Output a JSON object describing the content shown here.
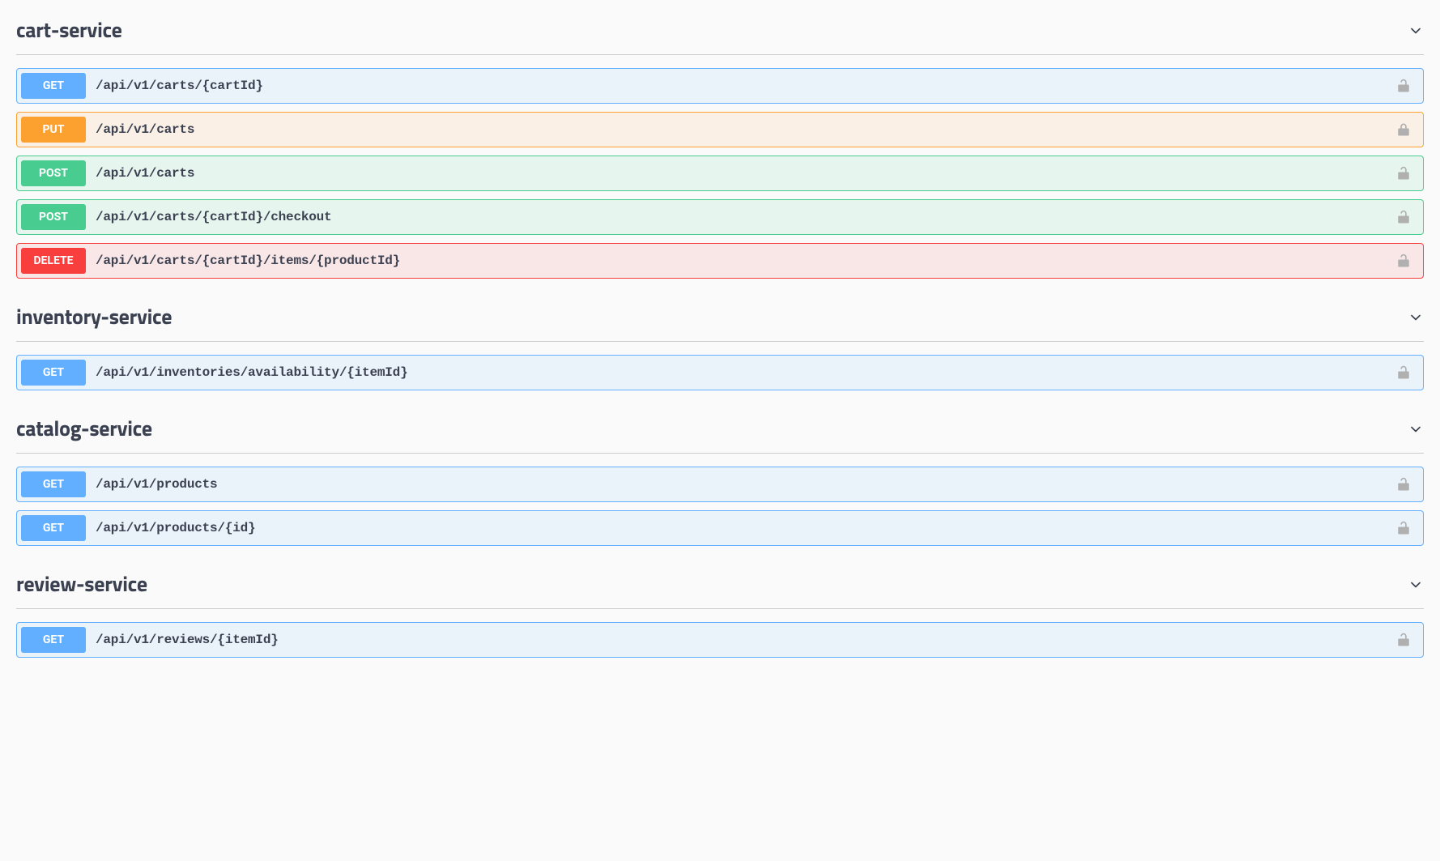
{
  "sections": [
    {
      "name": "cart-service",
      "ops": [
        {
          "method": "GET",
          "path": "/api/v1/carts/{cartId}",
          "locked": false
        },
        {
          "method": "PUT",
          "path": "/api/v1/carts",
          "locked": true
        },
        {
          "method": "POST",
          "path": "/api/v1/carts",
          "locked": false
        },
        {
          "method": "POST",
          "path": "/api/v1/carts/{cartId}/checkout",
          "locked": false
        },
        {
          "method": "DELETE",
          "path": "/api/v1/carts/{cartId}/items/{productId}",
          "locked": false
        }
      ]
    },
    {
      "name": "inventory-service",
      "ops": [
        {
          "method": "GET",
          "path": "/api/v1/inventories/availability/{itemId}",
          "locked": false
        }
      ]
    },
    {
      "name": "catalog-service",
      "ops": [
        {
          "method": "GET",
          "path": "/api/v1/products",
          "locked": false
        },
        {
          "method": "GET",
          "path": "/api/v1/products/{id}",
          "locked": false
        }
      ]
    },
    {
      "name": "review-service",
      "ops": [
        {
          "method": "GET",
          "path": "/api/v1/reviews/{itemId}",
          "locked": false
        }
      ]
    }
  ]
}
